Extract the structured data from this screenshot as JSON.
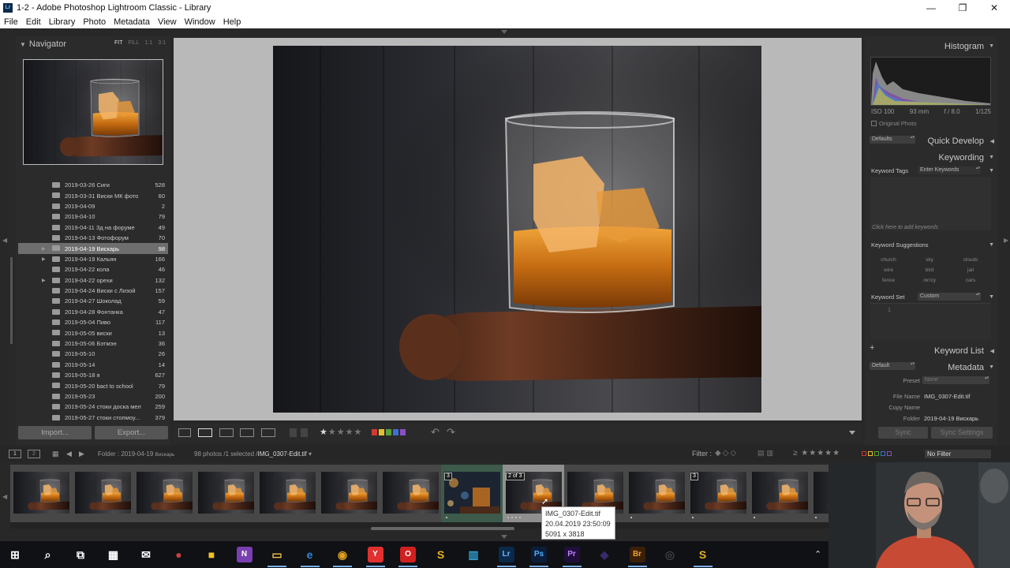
{
  "window": {
    "title": "1-2 - Adobe Photoshop Lightroom Classic - Library",
    "app_icon": "Lr",
    "minimize": "—",
    "maximize": "❐",
    "close": "✕"
  },
  "menu": [
    "File",
    "Edit",
    "Library",
    "Photo",
    "Metadata",
    "View",
    "Window",
    "Help"
  ],
  "navigator": {
    "title": "Navigator",
    "zoom_options": [
      "FIT",
      "FILL",
      "1:1",
      "3:1"
    ]
  },
  "folders": [
    {
      "name": "2019-03-26 Сиги",
      "count": "528"
    },
    {
      "name": "2019-03-31 Виски МК фото",
      "count": "60"
    },
    {
      "name": "2019-04-09",
      "count": "2"
    },
    {
      "name": "2019-04-10",
      "count": "79"
    },
    {
      "name": "2019-04-11 Зд на форуме",
      "count": "49"
    },
    {
      "name": "2019-04-13 Фотофорум",
      "count": "70"
    },
    {
      "name": "2019-04-19 Вискарь",
      "count": "98",
      "selected": true,
      "expandable": true
    },
    {
      "name": "2019-04-19 Кальян",
      "count": "166",
      "expandable": true
    },
    {
      "name": "2019-04-22 кола",
      "count": "46"
    },
    {
      "name": "2019-04-22 орехи",
      "count": "132",
      "expandable": true
    },
    {
      "name": "2019-04-24 Виски с Лизой",
      "count": "157"
    },
    {
      "name": "2019-04-27 Шоколад",
      "count": "59"
    },
    {
      "name": "2019-04-28 Фонтанка",
      "count": "47"
    },
    {
      "name": "2019-05-04 Пиво",
      "count": "117"
    },
    {
      "name": "2019-05-05 виски",
      "count": "13"
    },
    {
      "name": "2019-05-06 Бэтмэн",
      "count": "36"
    },
    {
      "name": "2019-05-10",
      "count": "26"
    },
    {
      "name": "2019-05-14",
      "count": "14"
    },
    {
      "name": "2019-05-18 я",
      "count": "627"
    },
    {
      "name": "2019-05-20 bact to school",
      "count": "79"
    },
    {
      "name": "2019-05-23",
      "count": "200"
    },
    {
      "name": "2019-05-24 стоки доска мел",
      "count": "259"
    },
    {
      "name": "2019-05-27 стоки стопмоу...",
      "count": "379"
    }
  ],
  "left_buttons": {
    "import": "Import...",
    "export": "Export..."
  },
  "toolbar": {
    "stars": "★★★★★",
    "label_colors": [
      "#d33a32",
      "#e3c030",
      "#5aa13a",
      "#3b6fd1",
      "#8a4fc2"
    ]
  },
  "right": {
    "histogram_title": "Histogram",
    "iso": "ISO 100",
    "focal": "93 mm",
    "aperture": "f / 8.0",
    "shutter": "1/125",
    "original_photo": "Original Photo",
    "quick_develop": "Quick Develop",
    "quick_develop_preset": "Defaults",
    "keywording": "Keywording",
    "keyword_tags_label": "Keyword Tags",
    "keyword_tags_value": "Enter Keywords",
    "keyword_hint": "Click here to add keywords",
    "keyword_suggestions_label": "Keyword Suggestions",
    "suggestions": [
      "church",
      "sky",
      "clouds",
      "wire",
      "bird",
      "jail",
      "fence",
      "лктсу",
      "cars"
    ],
    "keyword_set_label": "Keyword Set",
    "keyword_set_value": "Custom",
    "keyword_set_first": "1",
    "keyword_list": "Keyword List",
    "plus": "+",
    "metadata": "Metadata",
    "metadata_preset_select": "Default",
    "preset_label": "Preset",
    "preset_value": "None",
    "file_name_label": "File Name",
    "file_name_value": "IMG_0307-Edit.tif",
    "copy_name_label": "Copy Name",
    "folder_label": "Folder",
    "folder_value": "2019-04-19 Вискарь",
    "sync": "Sync",
    "sync_settings": "Sync Settings"
  },
  "filmstrip_bar": {
    "view1": "1",
    "view2": "2",
    "path_prefix": "Folder : 2019-04-19",
    "path_suffix": "Вискарь",
    "count": "98 photos /1 selected /",
    "selected_file": "IMG_0307-Edit.tif",
    "filter_label": "Filter :",
    "filter_stars": "≥ ★★★★★",
    "filter_value": "No Filter"
  },
  "filmstrip": {
    "cells": [
      {
        "badge": ""
      },
      {
        "badge": ""
      },
      {
        "badge": ""
      },
      {
        "badge": ""
      },
      {
        "badge": ""
      },
      {
        "badge": ""
      },
      {
        "badge": ""
      },
      {
        "badge": "3",
        "stack": true,
        "bokeh": true
      },
      {
        "badge": "2 of 3",
        "selected": true
      },
      {
        "badge": ""
      },
      {
        "badge": ""
      },
      {
        "badge": "3"
      },
      {
        "badge": ""
      },
      {
        "badge": ""
      }
    ]
  },
  "tooltip": {
    "name": "IMG_0307-Edit.tif",
    "date": "20.04.2019 23:50:09",
    "size": "5091 x 3818"
  },
  "taskbar": {
    "items": [
      "windows-logo",
      "search",
      "task-view",
      "calendar",
      "mail",
      "app-record",
      "sticky-notes",
      "onenote",
      "file-explorer",
      "edge",
      "chrome",
      "yandex",
      "opera",
      "app-s",
      "app-chart",
      "lightroom",
      "photoshop",
      "premiere",
      "app-purple",
      "bridge",
      "app-dial",
      "app-s2"
    ],
    "labels": {
      "onenote": "N",
      "lightroom": "Lr",
      "photoshop": "Ps",
      "premiere": "Pr",
      "bridge": "Br",
      "yandex": "Y",
      "opera": "O"
    }
  }
}
